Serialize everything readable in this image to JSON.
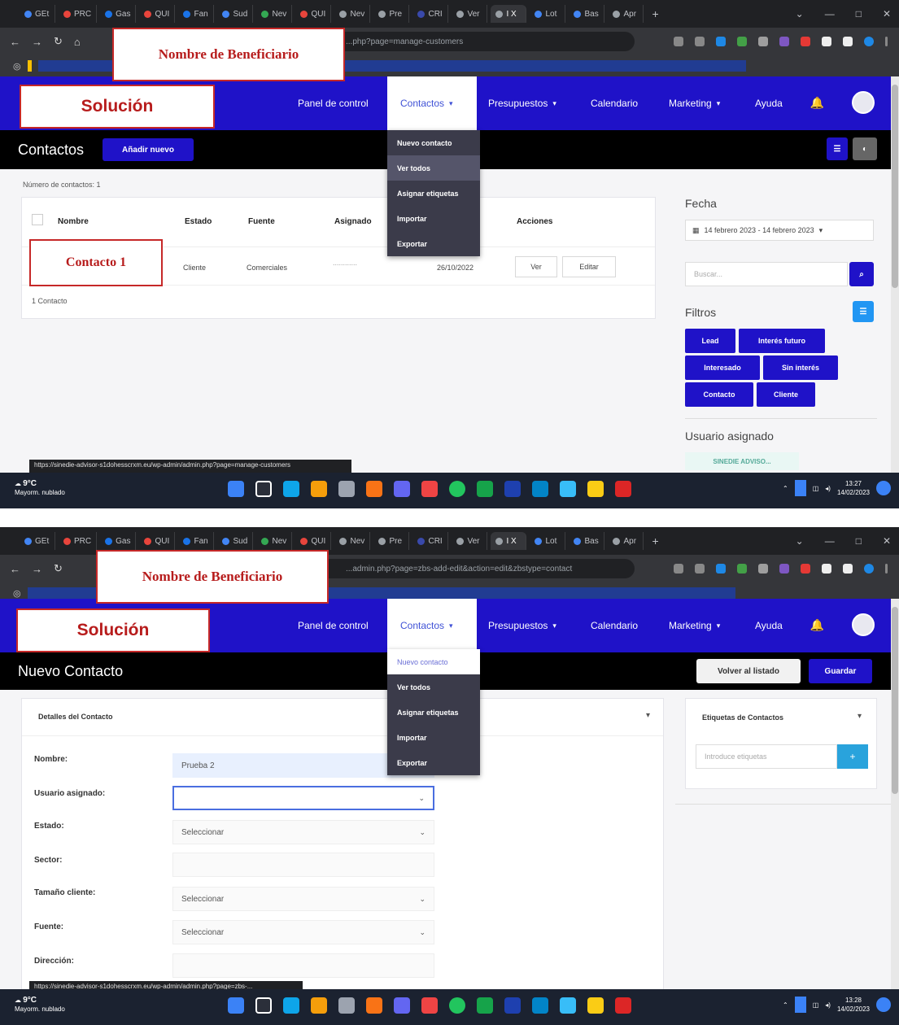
{
  "browser": {
    "tabs": [
      "GEt",
      "PRC",
      "Gas",
      "QUI",
      "Fan",
      "Sud",
      "Nev",
      "QUI",
      "Nev",
      "Pre",
      "CRI",
      "Ver",
      "I X",
      "Lot",
      "Bas",
      "Apr"
    ],
    "new_tab": "+",
    "url_1": "...php?page=manage-customers",
    "url_2": "...admin.php?page=zbs-add-edit&action=edit&zbstype=contact"
  },
  "overlay": {
    "beneficiary": "Nombre de Beneficiario",
    "solution": "Solución",
    "contact1": "Contacto 1"
  },
  "nav": {
    "items": [
      "Panel de control",
      "Contactos",
      "Presupuestos",
      "Calendario",
      "Marketing",
      "Ayuda"
    ]
  },
  "dropdown": {
    "items": [
      "Nuevo contacto",
      "Ver todos",
      "Asignar etiquetas",
      "Importar",
      "Exportar"
    ]
  },
  "screen1": {
    "page_title": "Contactos",
    "add_button": "Añadir nuevo",
    "count_label": "Número de contactos: 1",
    "table": {
      "headers": [
        "Nombre",
        "Estado",
        "Fuente",
        "Asignado",
        "",
        "Acciones"
      ],
      "row": {
        "estado": "Cliente",
        "fuente": "Comerciales",
        "asignado": "............",
        "fecha": "26/10/2022"
      },
      "actions": [
        "Ver",
        "Editar"
      ],
      "footer": "1 Contacto"
    },
    "sidebar": {
      "fecha_label": "Fecha",
      "date_range": "14 febrero 2023 - 14 febrero 2023",
      "search_placeholder": "Buscar...",
      "filters_label": "Filtros",
      "filters": [
        "Lead",
        "Interés futuro",
        "Interesado",
        "Sin interés",
        "Contacto",
        "Cliente"
      ],
      "assigned_label": "Usuario asignado",
      "assigned_value": "SINEDIE ADVISO..."
    },
    "status_url": "https://sinedie-advisor-s1dohesscrxm.eu/wp-admin/admin.php?page=manage-customers"
  },
  "screen2": {
    "page_title": "Nuevo Contacto",
    "back_button": "Volver al listado",
    "save_button": "Guardar",
    "details_title": "Detalles del Contacto",
    "fields": [
      {
        "label": "Nombre:",
        "value": "Prueba 2"
      },
      {
        "label": "Usuario asignado:",
        "value": ""
      },
      {
        "label": "Estado:",
        "value": "Seleccionar"
      },
      {
        "label": "Sector:",
        "value": ""
      },
      {
        "label": "Tamaño cliente:",
        "value": "Seleccionar"
      },
      {
        "label": "Fuente:",
        "value": "Seleccionar"
      },
      {
        "label": "Dirección:",
        "value": ""
      }
    ],
    "tags_title": "Etiquetas de Contactos",
    "tags_placeholder": "Introduce etiquetas",
    "tags_add": "+",
    "status_url": "https://sinedie-advisor-s1dohesscrxm.eu/wp-admin/admin.php?page=zbs-..."
  },
  "taskbar": {
    "temp": "9°C",
    "weather": "Mayorm. nublado",
    "time1": "13:27",
    "time2": "13:28",
    "date": "14/02/2023"
  },
  "colors": {
    "brand": "#1f12c8",
    "overlay_red": "#c62828"
  }
}
